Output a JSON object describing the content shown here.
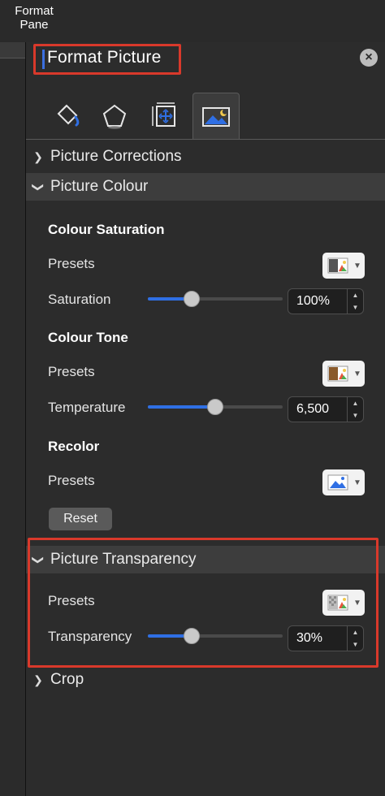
{
  "topbar": {
    "label_line1": "Format",
    "label_line2": "Pane"
  },
  "pane": {
    "title": "Format Picture",
    "close_icon": "close-circle-icon",
    "tabs": [
      {
        "name": "fill-line",
        "icon": "paint-bucket-icon"
      },
      {
        "name": "effects",
        "icon": "pentagon-icon"
      },
      {
        "name": "size-properties",
        "icon": "size-position-icon"
      },
      {
        "name": "picture",
        "icon": "picture-icon",
        "active": true
      }
    ],
    "sections": {
      "corrections": {
        "label": "Picture Corrections",
        "expanded": false
      },
      "colour": {
        "label": "Picture Colour",
        "expanded": true,
        "saturation": {
          "heading": "Colour Saturation",
          "presets_label": "Presets",
          "slider_label": "Saturation",
          "value": "100%",
          "level": 0.3
        },
        "tone": {
          "heading": "Colour Tone",
          "presets_label": "Presets",
          "slider_label": "Temperature",
          "value": "6,500",
          "level": 0.5
        },
        "recolor": {
          "heading": "Recolor",
          "presets_label": "Presets",
          "reset_label": "Reset"
        }
      },
      "transparency": {
        "label": "Picture Transparency",
        "expanded": true,
        "presets_label": "Presets",
        "slider_label": "Transparency",
        "value": "30%",
        "level": 0.3
      },
      "crop": {
        "label": "Crop",
        "expanded": false
      }
    }
  },
  "colors": {
    "accent": "#2f6fe4",
    "highlight": "#d9392b",
    "pane_bg": "#2c2c2c"
  }
}
